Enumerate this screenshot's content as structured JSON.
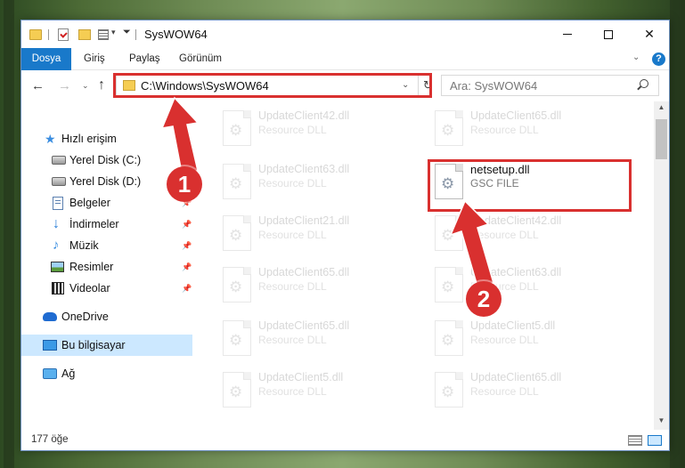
{
  "window": {
    "title": "SysWOW64",
    "minimize_icon": "minimize-icon",
    "maximize_icon": "maximize-icon",
    "close_icon": "close-icon",
    "close_glyph": "✕"
  },
  "ribbon": {
    "tabs": [
      {
        "label": "Dosya"
      },
      {
        "label": "Giriş"
      },
      {
        "label": "Paylaş"
      },
      {
        "label": "Görünüm"
      }
    ],
    "help_glyph": "?",
    "expand_glyph": "⌄"
  },
  "nav": {
    "back_glyph": "←",
    "forward_glyph": "→",
    "recent_glyph": "⌄",
    "up_glyph": "↑"
  },
  "address": {
    "path": "C:\\Windows\\SysWOW64",
    "dropdown_glyph": "⌄",
    "refresh_glyph": "↻"
  },
  "search": {
    "placeholder": "Ara: SysWOW64"
  },
  "sidebar": {
    "items": [
      {
        "label": "Hızlı erişim",
        "icon": "star-icon"
      },
      {
        "label": "Yerel Disk (C:)",
        "icon": "drive-icon",
        "pinned": true
      },
      {
        "label": "Yerel Disk (D:)",
        "icon": "drive-icon",
        "pinned": true
      },
      {
        "label": "Belgeler",
        "icon": "documents-icon",
        "pinned": true
      },
      {
        "label": "İndirmeler",
        "icon": "download-icon",
        "pinned": true
      },
      {
        "label": "Müzik",
        "icon": "music-icon",
        "pinned": true
      },
      {
        "label": "Resimler",
        "icon": "pictures-icon",
        "pinned": true
      },
      {
        "label": "Videolar",
        "icon": "videos-icon",
        "pinned": true
      },
      {
        "label": "OneDrive",
        "icon": "cloud-icon"
      },
      {
        "label": "Bu bilgisayar",
        "icon": "computer-icon",
        "selected": true
      },
      {
        "label": "Ağ",
        "icon": "network-icon"
      }
    ],
    "pin_glyph": "📌"
  },
  "files": {
    "left_column": [
      {
        "name": "UpdateClient42.dll",
        "type": "Resource DLL"
      },
      {
        "name": "UpdateClient63.dll",
        "type": "Resource DLL"
      },
      {
        "name": "UpdateClient21.dll",
        "type": "Resource DLL"
      },
      {
        "name": "UpdateClient65.dll",
        "type": "Resource DLL"
      },
      {
        "name": "UpdateClient65.dll",
        "type": "Resource DLL"
      },
      {
        "name": "UpdateClient5.dll",
        "type": "Resource DLL"
      }
    ],
    "right_column": [
      {
        "name": "UpdateClient65.dll",
        "type": "Resource DLL"
      },
      {
        "name": "netsetup.dll",
        "type": "GSC FILE",
        "highlighted": true
      },
      {
        "name": "UpdateClient42.dll",
        "type": "Resource DLL"
      },
      {
        "name": "UpdateClient63.dll",
        "type": "Resource DLL"
      },
      {
        "name": "UpdateClient5.dll",
        "type": "Resource DLL"
      },
      {
        "name": "UpdateClient65.dll",
        "type": "Resource DLL"
      }
    ]
  },
  "statusbar": {
    "count": "177 öğe"
  },
  "annotations": {
    "marker_1": "1",
    "marker_2": "2",
    "color": "#d9302f"
  },
  "colors": {
    "accent": "#1979ca",
    "selection": "#cce8ff",
    "highlight": "#d9302f"
  }
}
